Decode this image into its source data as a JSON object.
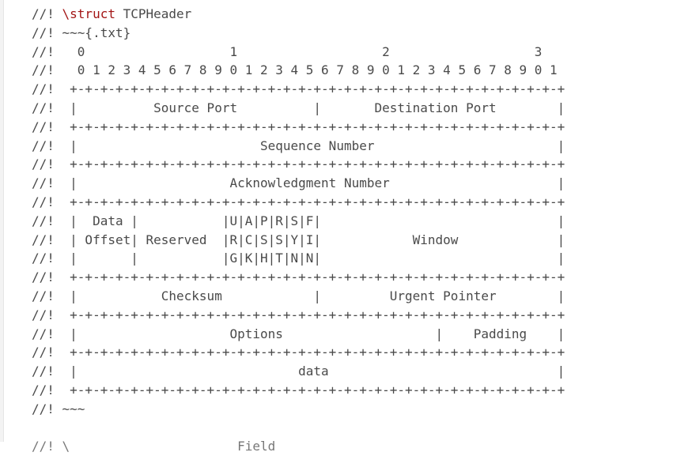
{
  "code": {
    "lines": [
      "//! ",
      "//! ~~~{.txt}",
      "//!   0                   1                   2                   3",
      "//!   0 1 2 3 4 5 6 7 8 9 0 1 2 3 4 5 6 7 8 9 0 1 2 3 4 5 6 7 8 9 0 1",
      "//!  +-+-+-+-+-+-+-+-+-+-+-+-+-+-+-+-+-+-+-+-+-+-+-+-+-+-+-+-+-+-+-+-+",
      "//!  |          Source Port          |       Destination Port        |",
      "//!  +-+-+-+-+-+-+-+-+-+-+-+-+-+-+-+-+-+-+-+-+-+-+-+-+-+-+-+-+-+-+-+-+",
      "//!  |                        Sequence Number                        |",
      "//!  +-+-+-+-+-+-+-+-+-+-+-+-+-+-+-+-+-+-+-+-+-+-+-+-+-+-+-+-+-+-+-+-+",
      "//!  |                    Acknowledgment Number                      |",
      "//!  +-+-+-+-+-+-+-+-+-+-+-+-+-+-+-+-+-+-+-+-+-+-+-+-+-+-+-+-+-+-+-+-+",
      "//!  |  Data |           |U|A|P|R|S|F|                               |",
      "//!  | Offset| Reserved  |R|C|S|S|Y|I|            Window             |",
      "//!  |       |           |G|K|H|T|N|N|                               |",
      "//!  +-+-+-+-+-+-+-+-+-+-+-+-+-+-+-+-+-+-+-+-+-+-+-+-+-+-+-+-+-+-+-+-+",
      "//!  |           Checksum            |         Urgent Pointer        |",
      "//!  +-+-+-+-+-+-+-+-+-+-+-+-+-+-+-+-+-+-+-+-+-+-+-+-+-+-+-+-+-+-+-+-+",
      "//!  |                    Options                    |    Padding    |",
      "//!  +-+-+-+-+-+-+-+-+-+-+-+-+-+-+-+-+-+-+-+-+-+-+-+-+-+-+-+-+-+-+-+-+",
      "//!  |                             data                              |",
      "//!  +-+-+-+-+-+-+-+-+-+-+-+-+-+-+-+-+-+-+-+-+-+-+-+-+-+-+-+-+-+-+-+-+",
      "//! ~~~",
      "",
      "//! \\                      Field"
    ],
    "struct_keyword": "\\struct",
    "struct_name": "TCPHeader"
  },
  "colors": {
    "text": "#4a4a4a",
    "keyword": "#a31515",
    "background": "#ffffff"
  }
}
